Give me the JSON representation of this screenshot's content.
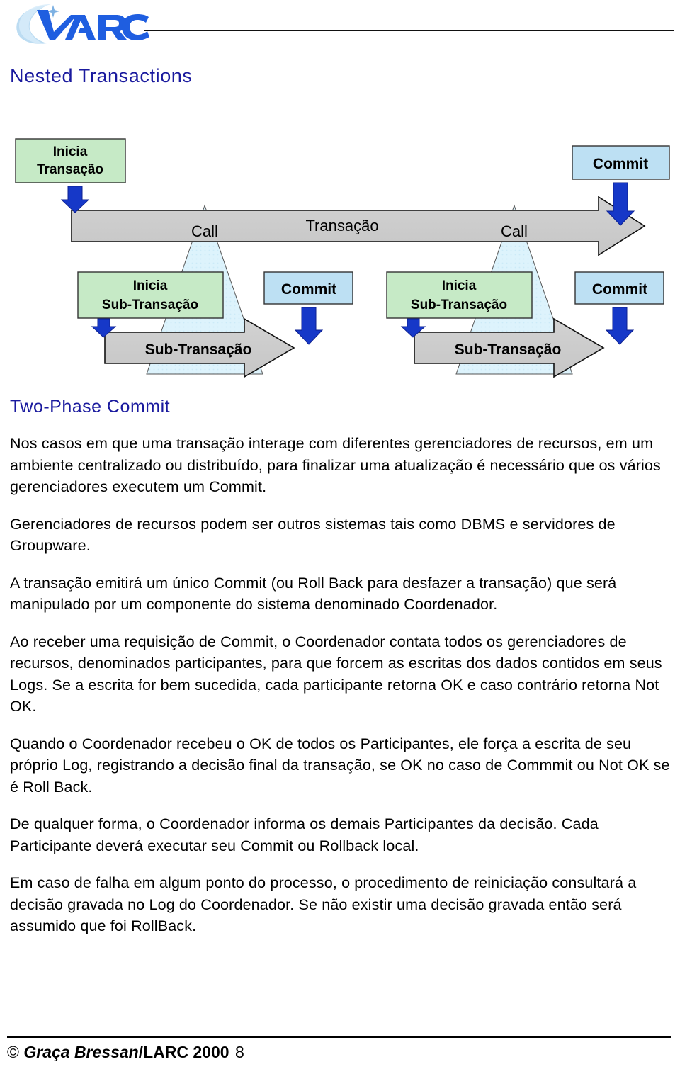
{
  "header": {
    "logo_text": "LARC",
    "logo_icon": "larc-swoosh-logo"
  },
  "page_title": "Nested Transactions",
  "diagram": {
    "name": "nested-transactions-diagram",
    "colors": {
      "box_green": "#c6eac6",
      "box_blue": "#bde0f3",
      "arrow_gray": "#cccccc",
      "triangle_blue": "#dcf2fb",
      "arrow_blue": "#1638c8",
      "outline": "#000000"
    },
    "nodes": {
      "start_transaction": "Inicia\nTransação",
      "start_transaction_line1": "Inicia",
      "start_transaction_line2": "Transação",
      "commit_top": "Commit",
      "transaction_arrow_label": "Transação",
      "call_left": "Call",
      "call_right": "Call",
      "start_subtransaction_line1": "Inicia",
      "start_subtransaction_line2": "Sub-Transação",
      "commit_sub_left": "Commit",
      "commit_sub_right": "Commit",
      "sub_arrow_label_left": "Sub-Transação",
      "sub_arrow_label_right": "Sub-Transação"
    }
  },
  "content": {
    "heading": "Two-Phase Commit",
    "paragraphs": [
      "Nos casos em que uma transação interage com diferentes gerenciadores de recursos, em um ambiente centralizado ou distribuído, para finalizar uma atualização é necessário que os vários gerenciadores executem um Commit.",
      "Gerenciadores de recursos podem ser outros sistemas tais como DBMS e servidores de Groupware.",
      "A transação emitirá um único Commit (ou Roll Back para desfazer a transação) que será manipulado por um componente do sistema denominado Coordenador.",
      "Ao receber uma requisição de Commit, o Coordenador contata todos os gerenciadores de recursos, denominados participantes, para que forcem as escritas dos dados contidos em seus Logs. Se a escrita for bem sucedida, cada participante retorna OK e caso contrário retorna Not OK.",
      "Quando o Coordenador recebeu o OK de todos os Participantes, ele força a escrita de seu próprio Log, registrando a decisão final da transação, se OK no caso de Commmit ou Not OK se é Roll Back.",
      "De qualquer forma, o Coordenador informa os demais Participantes da decisão. Cada Participante deverá executar seu Commit ou Rollback local.",
      "Em caso de falha em algum ponto do processo, o procedimento de reiniciação consultará a decisão gravada no Log do Coordenador. Se não existir uma decisão gravada então será assumido que foi RollBack."
    ]
  },
  "footer": {
    "copyright_mark": "©",
    "author": "Graça Bressan",
    "org": "/LARC 2000",
    "page_number": "8"
  },
  "colors": {
    "heading_blue": "#1a1a9e",
    "text_black": "#000000",
    "logo_blue": "#1f5ee0",
    "logo_pale": "#cfe6f7"
  }
}
